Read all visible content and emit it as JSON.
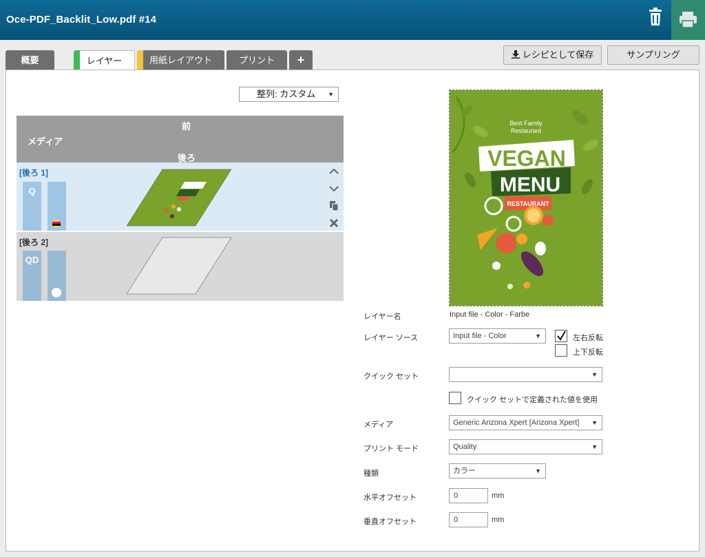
{
  "window": {
    "title": "Oce-PDF_Backlit_Low.pdf #14"
  },
  "header_icons": {
    "delete": "trash-icon",
    "print": "printer-icon"
  },
  "tabs": [
    {
      "label": "概要",
      "active": false
    },
    {
      "label": "レイヤー",
      "active": true,
      "color": "#3fba5a"
    },
    {
      "label": "用紙レイアウト",
      "active": false,
      "color": "#f3c53a"
    },
    {
      "label": "プリント",
      "active": false
    },
    {
      "label": "+",
      "active": false
    }
  ],
  "actions": {
    "save_recipe": "レシピとして保存",
    "sampling": "サンプリング"
  },
  "sort": {
    "value": "整列: カスタム"
  },
  "layer_list": {
    "header_front": "前",
    "header_media": "メディア",
    "header_back": "後ろ",
    "rows": [
      {
        "label": "[後ろ 1]",
        "mode": "Q",
        "selected": true
      },
      {
        "label": "[後ろ 2]",
        "mode": "QD",
        "selected": false
      }
    ]
  },
  "preview": {
    "line1": "Best Family",
    "line2": "Restaurant",
    "vegan": "VEGAN",
    "menu": "MENU",
    "restaurant": "RESTAURANT"
  },
  "form": {
    "layer_name_label": "レイヤー名",
    "layer_name_value": "Input file - Color - Farbe",
    "layer_source_label": "レイヤー ソース",
    "layer_source_value": "Input file - Color",
    "flip_horizontal_label": "左右反転",
    "flip_horizontal_checked": true,
    "flip_vertical_label": "上下反転",
    "flip_vertical_checked": false,
    "quickset_label": "クイック セット",
    "quickset_value": "",
    "use_quickset_label": "クイック セットで定義された値を使用",
    "use_quickset_checked": false,
    "media_label": "メディア",
    "media_value": "Generic Arizona Xpert [Arizona Xpert]",
    "print_mode_label": "プリント モード",
    "print_mode_value": "Quality",
    "type_label": "種類",
    "type_value": "カラー",
    "h_offset_label": "水平オフセット",
    "h_offset_value": "0",
    "v_offset_label": "垂直オフセット",
    "v_offset_value": "0",
    "unit": "mm"
  },
  "colors": {
    "titlebar": "#075277",
    "print_button": "#2f8a6f",
    "poster_green": "#7aa32c"
  }
}
